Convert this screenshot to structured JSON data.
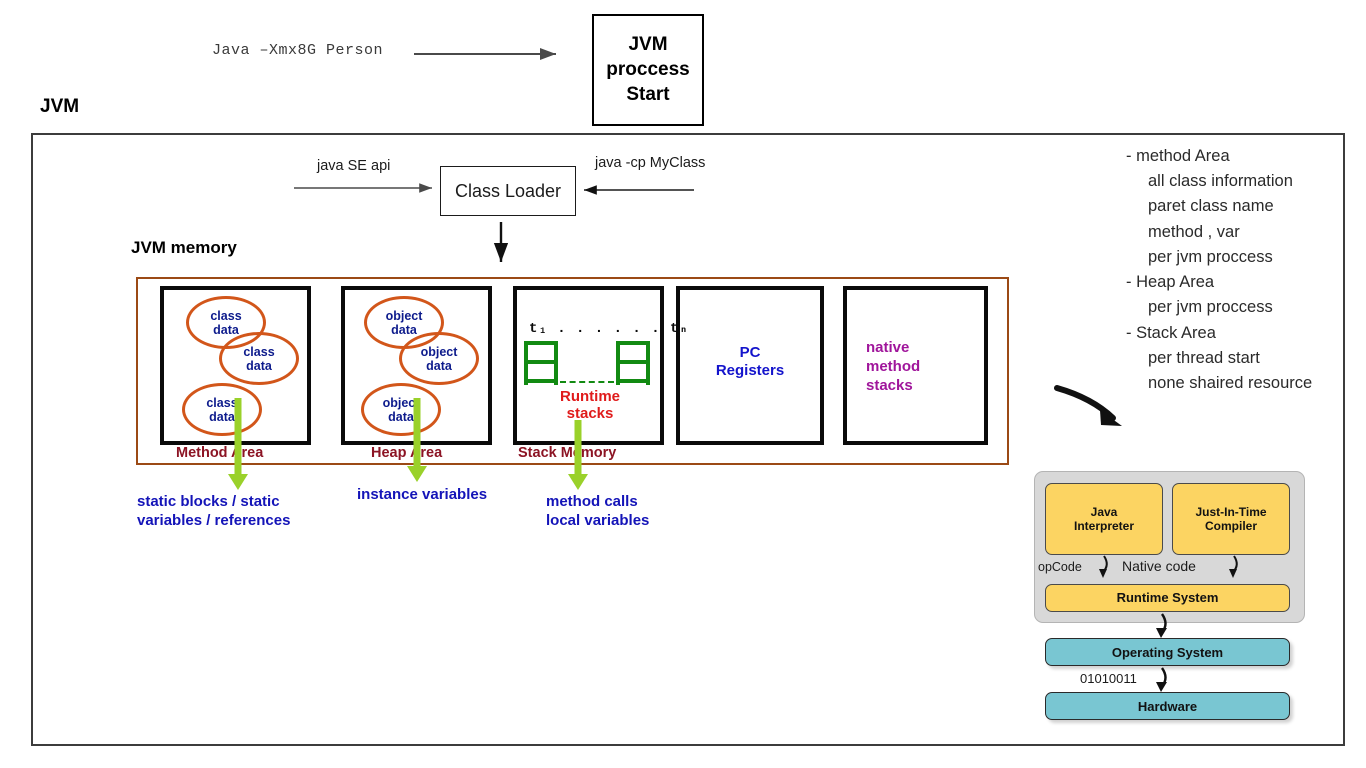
{
  "top": {
    "command": "Java –Xmx8G Person",
    "process_box": [
      "JVM",
      "proccess",
      "Start"
    ]
  },
  "frame": {
    "title": "JVM",
    "memory_title": "JVM memory"
  },
  "class_loader": {
    "label": "Class Loader",
    "left_arrow_label": "java SE api",
    "right_arrow_label": "java -cp MyClass"
  },
  "memory_areas": [
    {
      "caption": "Method Area",
      "bubbles": [
        {
          "line1": "class",
          "line2": "data"
        },
        {
          "line1": "class",
          "line2": "data"
        },
        {
          "line1": "class",
          "line2": "data"
        }
      ]
    },
    {
      "caption": "Heap Area",
      "bubbles": [
        {
          "line1": "object",
          "line2": "data"
        },
        {
          "line1": "object",
          "line2": "data"
        },
        {
          "line1": "object",
          "line2": "data"
        }
      ]
    },
    {
      "caption": "Stack Memory",
      "thread_label": "t₁ . . . . . . tₙ",
      "inner_label_line1": "Runtime",
      "inner_label_line2": "stacks"
    }
  ],
  "pc_registers": {
    "line1": "PC",
    "line2": "Registers"
  },
  "native_method_stacks": {
    "line1": "native",
    "line2": "method",
    "line3": "stacks"
  },
  "flow_captions": [
    {
      "line1": "static blocks / static",
      "line2": "variables / references"
    },
    {
      "line1": "instance variables",
      "line2": ""
    },
    {
      "line1": "method calls",
      "line2": "local variables"
    }
  ],
  "annotations": [
    {
      "text": "- method Area",
      "level": "head"
    },
    {
      "text": "all class information",
      "level": "sub"
    },
    {
      "text": "paret class name",
      "level": "sub"
    },
    {
      "text": "method , var",
      "level": "sub"
    },
    {
      "text": "per jvm proccess",
      "level": "sub"
    },
    {
      "text": "- Heap Area",
      "level": "head"
    },
    {
      "text": "per jvm proccess",
      "level": "sub"
    },
    {
      "text": "- Stack Area",
      "level": "head"
    },
    {
      "text": "per thread start",
      "level": "sub"
    },
    {
      "text": "none shaired resource",
      "level": "sub"
    }
  ],
  "execution": {
    "interpreter": {
      "line1": "Java",
      "line2": "Interpreter"
    },
    "jit": {
      "line1": "Just-In-Time",
      "line2": "Compiler"
    },
    "runtime_system": "Runtime System",
    "opcode_label": "opCode",
    "native_code_label": "Native code",
    "operating_system": "Operating System",
    "hardware": "Hardware",
    "binary_label": "01010011"
  },
  "colors": {
    "bubble_stroke": "#d2561a",
    "bubble_text": "#0d1b8c",
    "area_caption": "#8c1424",
    "memory_border": "#9b4a15",
    "green_arrow": "#9ad12a",
    "ladder_green": "#128a12",
    "runtime_red": "#e01b1b",
    "pc_blue": "#1414cc",
    "native_purple": "#a0159b",
    "caption_blue": "#1414b8",
    "yellow_box": "#fcd462",
    "teal_box": "#79c6d2"
  }
}
